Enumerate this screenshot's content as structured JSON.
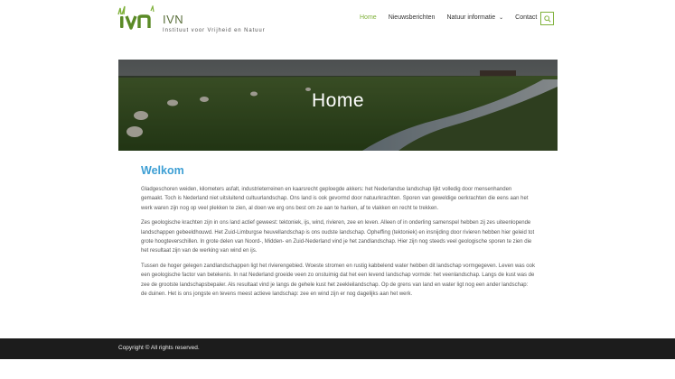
{
  "site": {
    "title": "IVN",
    "tagline": "Instituut voor Vrijheid en Natuur",
    "logo_text": "ivn"
  },
  "nav": {
    "items": [
      {
        "label": "Home",
        "active": true
      },
      {
        "label": "Nieuwsberichten",
        "active": false
      },
      {
        "label": "Natuur informatie",
        "active": false,
        "dropdown": true
      },
      {
        "label": "Contact",
        "active": false
      }
    ],
    "search_icon": "search-icon",
    "accent_color": "#7fb13a"
  },
  "hero": {
    "title": "Home"
  },
  "content": {
    "heading": "Welkom",
    "paragraphs": [
      "Gladgeschoren weiden, kilometers asfalt, industrieterreinen en kaarsrecht geploegde akkers: het Nederlandse landschap lijkt volledig door mensenhanden gemaakt. Toch is Nederland niet uitsluitend cultuurlandschap. Ons land is ook gevormd door natuurkrachten. Sporen van geweldige oerkrachten die eens aan het werk waren zijn nog op veel plekken te zien, al doen we erg ons best om ze aan te harken, af te vlakken en recht te trekken.",
      "Zes geologische krachten zijn in ons land actief geweest: tektoniek, ijs, wind, rivieren, zee en leven. Alleen of in onderling samenspel hebben zij zes uiteenlopende landschappen gebeeldhouwd. Het Zuid-Limburgse heuvellandschap is ons oudste landschap. Opheffing (tektoniek) en insnijding door rivieren hebben hier geleid tot grote hoogteverschillen. In grote delen van Noord-, Midden- en Zuid-Nederland vind je het zandlandschap. Hier zijn nog steeds veel geologische sporen te zien die het resultaat zijn van de werking van wind en ijs.",
      "Tussen de hoger gelegen zandlandschappen ligt het rivierengebied. Woeste stromen en rustig kabbelend water hebben dit landschap vormgegeven. Leven was ook een geologische factor van betekenis. In nat Nederland groeide veen zo onstuimig dat het een levend landschap vormde: het veenlandschap. Langs de kust was de zee de grootste landschapsbepaler. Als resultaat vind je langs de gehele kust het zeekleilandschap. Op de grens van land en water ligt nog een ander landschap: de duinen. Het is ons jongste en tevens meest actieve landschap: zee en wind zijn er nog dagelijks aan het werk."
    ],
    "heading_color": "#3e9fd4"
  },
  "footer": {
    "text": "Copyright © All rights reserved."
  }
}
